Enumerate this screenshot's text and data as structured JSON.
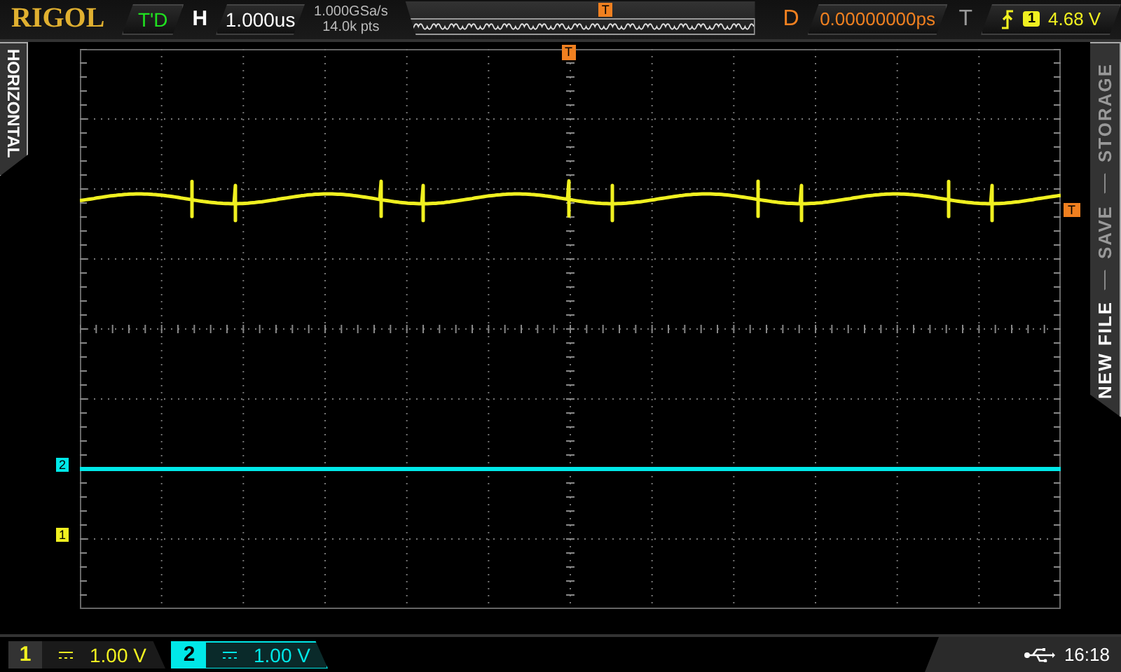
{
  "top_bar": {
    "logo": "RIGOL",
    "run_status": "T'D",
    "timebase": {
      "label": "H",
      "value": "1.000us"
    },
    "acquisition": {
      "sample_rate": "1.000GSa/s",
      "memory_depth": "14.0k pts"
    },
    "position_marker": "T",
    "delay": {
      "label": "D",
      "value": "0.00000000ps"
    },
    "trigger": {
      "label": "T",
      "source": "1",
      "level": "4.68 V"
    }
  },
  "left_menu": {
    "label": "HORIZONTAL"
  },
  "waveform": {
    "trigger_position_marker": "T",
    "trigger_level_marker": "T",
    "channel_markers": [
      {
        "label": "2",
        "color": "#00e8e8"
      },
      {
        "label": "1",
        "color": "#f0f020"
      }
    ]
  },
  "right_menu": {
    "items": [
      {
        "label": "STORAGE",
        "selected": false
      },
      {
        "label": "SAVE",
        "selected": false
      },
      {
        "label": "NEW FILE",
        "selected": true
      }
    ]
  },
  "bottom_bar": {
    "channels": [
      {
        "number": "1",
        "scale": "1.00 V",
        "color": "#f0f020",
        "selected": false
      },
      {
        "number": "2",
        "scale": "1.00 V",
        "color": "#00e8e8",
        "selected": true
      }
    ],
    "time": "16:18"
  }
}
